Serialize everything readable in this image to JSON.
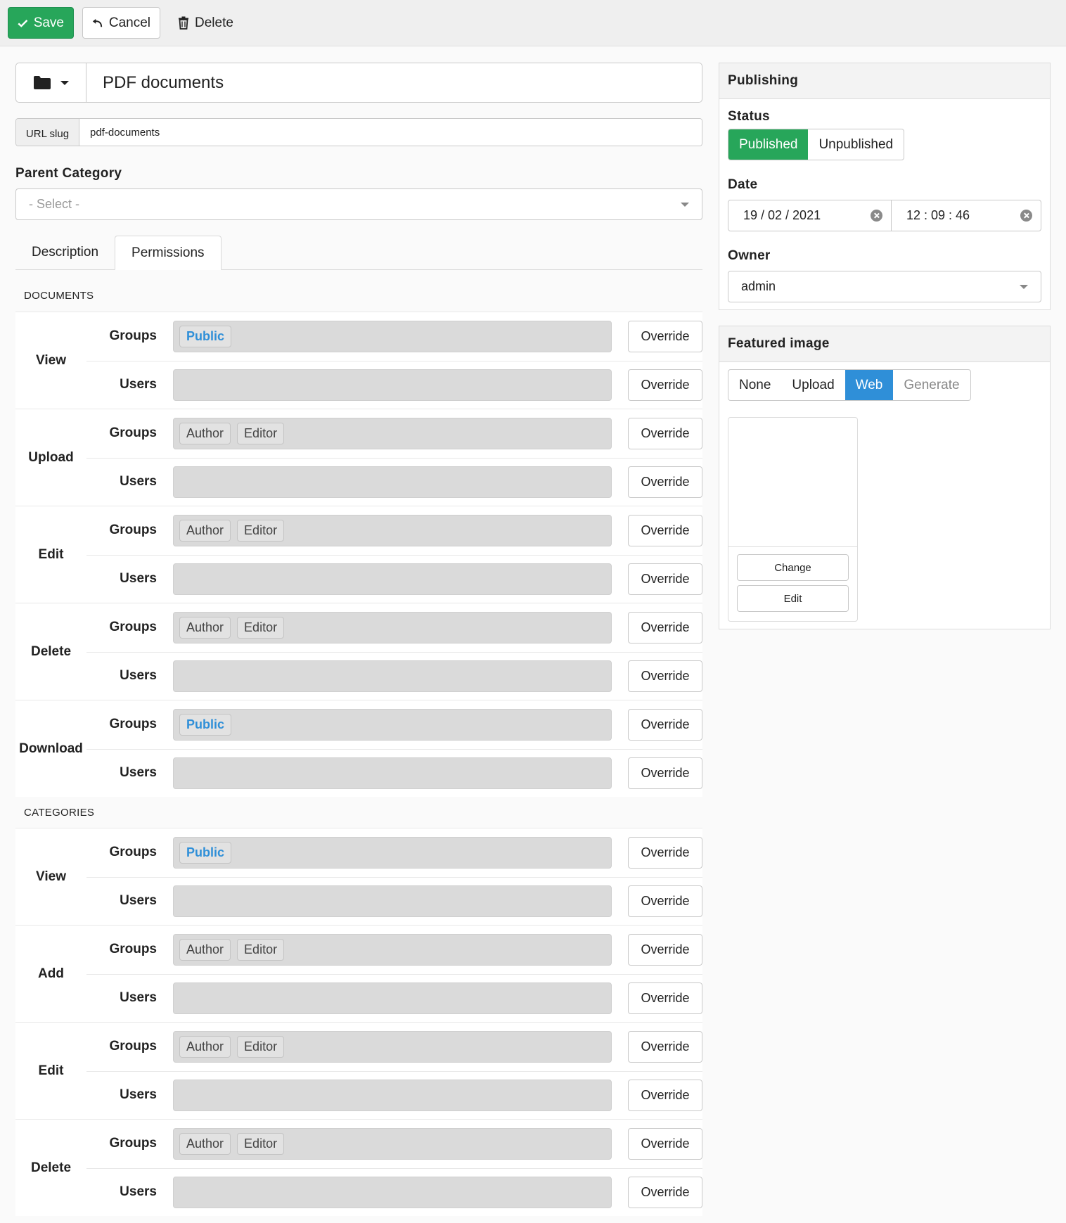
{
  "toolbar": {
    "save_label": "Save",
    "cancel_label": "Cancel",
    "delete_label": "Delete"
  },
  "title": {
    "value": "PDF documents"
  },
  "slug": {
    "label": "URL slug",
    "value": "pdf-documents"
  },
  "parent_category": {
    "label": "Parent Category",
    "placeholder": "- Select -"
  },
  "tabs": [
    {
      "label": "Description",
      "active": false
    },
    {
      "label": "Permissions",
      "active": true
    }
  ],
  "permissions": {
    "documents": {
      "title": "DOCUMENTS",
      "actions": [
        {
          "label": "View",
          "groups": [
            "Public"
          ],
          "users": []
        },
        {
          "label": "Upload",
          "groups": [
            "Author",
            "Editor"
          ],
          "users": []
        },
        {
          "label": "Edit",
          "groups": [
            "Author",
            "Editor"
          ],
          "users": []
        },
        {
          "label": "Delete",
          "groups": [
            "Author",
            "Editor"
          ],
          "users": []
        },
        {
          "label": "Download",
          "groups": [
            "Public"
          ],
          "users": []
        }
      ]
    },
    "categories": {
      "title": "CATEGORIES",
      "actions": [
        {
          "label": "View",
          "groups": [
            "Public"
          ],
          "users": []
        },
        {
          "label": "Add",
          "groups": [
            "Author",
            "Editor"
          ],
          "users": []
        },
        {
          "label": "Edit",
          "groups": [
            "Author",
            "Editor"
          ],
          "users": []
        },
        {
          "label": "Delete",
          "groups": [
            "Author",
            "Editor"
          ],
          "users": []
        }
      ]
    },
    "groups_label": "Groups",
    "users_label": "Users",
    "override_label": "Override"
  },
  "publishing": {
    "title": "Publishing",
    "status_label": "Status",
    "status_options": [
      "Published",
      "Unpublished"
    ],
    "status_selected": "Published",
    "date_label": "Date",
    "date_value": "19 / 02 / 2021",
    "time_value": "12 : 09 : 46",
    "owner_label": "Owner",
    "owner_value": "admin"
  },
  "featured_image": {
    "title": "Featured image",
    "options": [
      "None",
      "Upload",
      "Web",
      "Generate"
    ],
    "selected": "Web",
    "change_label": "Change",
    "edit_label": "Edit"
  },
  "colors": {
    "green": "#27a65a",
    "blue": "#2f8fd8"
  }
}
